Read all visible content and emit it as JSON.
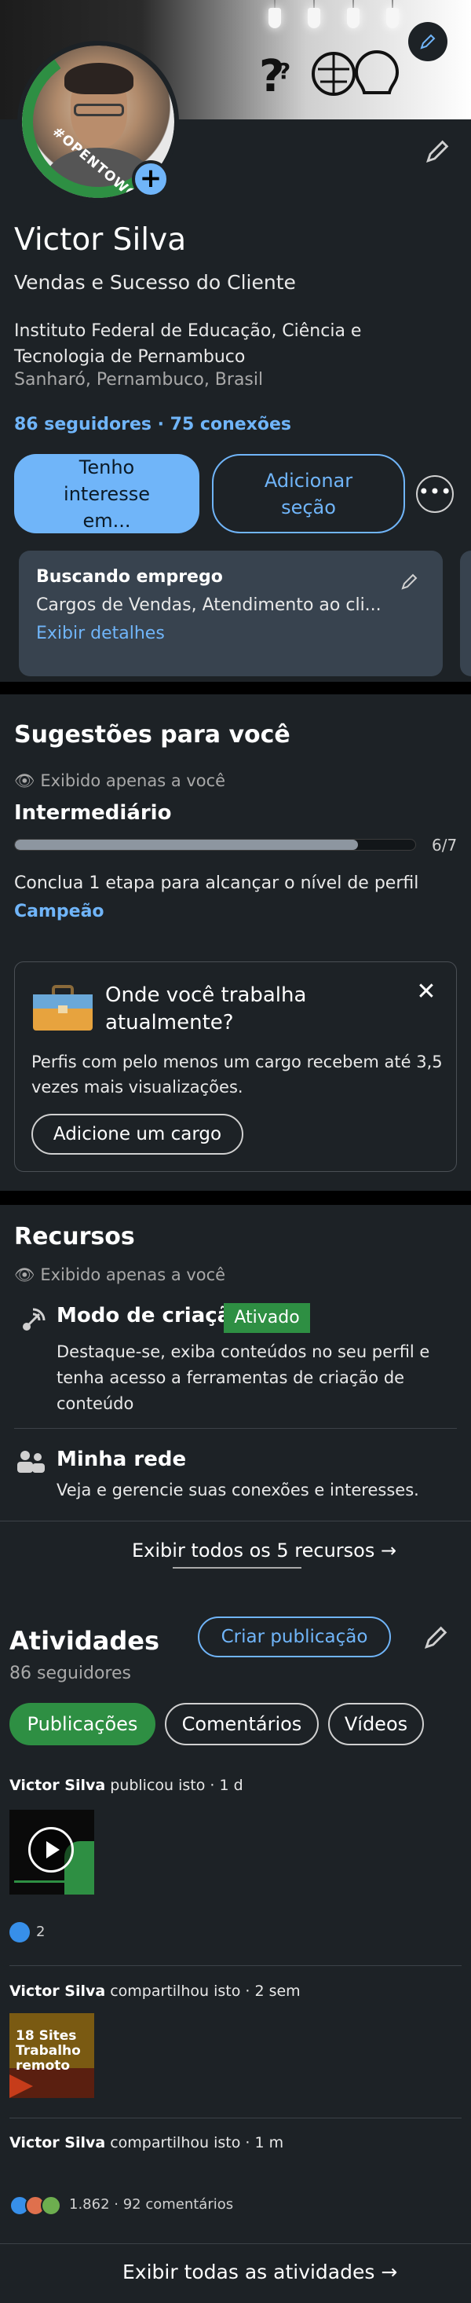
{
  "profile": {
    "open_to_work_badge": "#OPENTOWORK",
    "name": "Victor Silva",
    "headline": "Vendas e Sucesso do Cliente",
    "education": " Instituto Federal de Educação, Ciência e Tecnologia de Pernambuco",
    "location": "Sanharó, Pernambuco, Brasil",
    "connections": "86 seguidores · 75 conexões",
    "interest_button": [
      "Tenho",
      "interesse",
      "em..."
    ],
    "add_section_button": "Adicionar seção",
    "more_button": "•••"
  },
  "open_to_work": {
    "title": "Buscando emprego",
    "roles": "Cargos de Vendas, Atendimento ao cli...",
    "details_link": "Exibir detalhes"
  },
  "suggestions": {
    "title": "Sugestões para você",
    "private_note": "Exibido apenas a você",
    "level": "Intermediário",
    "progress_fraction": 0.857,
    "progress_label": "6/7",
    "description": "Conclua 1 etapa para alcançar o nível de perfil",
    "next_level": "Campeão",
    "job_question": "Onde você trabalha atualmente?",
    "job_description": "Perfis com pelo menos um cargo recebem até 3,5 vezes mais visualizações.",
    "job_button": "Adicione um cargo"
  },
  "resources": {
    "title": "Recursos",
    "private_note": "Exibido apenas a você",
    "creator_label": "Modo de criação",
    "creator_status": "Ativado",
    "creator_desc": "Destaque-se, exiba conteúdos no seu perfil e tenha acesso a ferramentas de criação de conteúdo",
    "network_label": "Minha rede",
    "network_desc": "Veja e gerencie suas conexões e interesses.",
    "show_all": "Exibir todos os 5 recursos →"
  },
  "activity": {
    "title": "Atividades",
    "followers": "86 seguidores",
    "create_post": "Criar publicação",
    "tabs": [
      "Publicações",
      "Comentários",
      "Vídeos"
    ],
    "posts": [
      {
        "author": "Victor Silva",
        "action": " publicou isto · 1 d",
        "reactions": "2"
      },
      {
        "author": "Victor Silva",
        "action": " compartilhou isto · 2 sem",
        "thumb_text": "18 Sites Trabalho remoto"
      },
      {
        "author": "Victor Silva",
        "action": " compartilhou isto · 1 m",
        "reactions": "1.862 · 92 comentários"
      }
    ],
    "show_all": "Exibir todas as atividades →"
  },
  "colors": {
    "accent": "#70b5f9",
    "green": "#2e8f43",
    "card": "#1d2226",
    "surface": "#38434f"
  }
}
